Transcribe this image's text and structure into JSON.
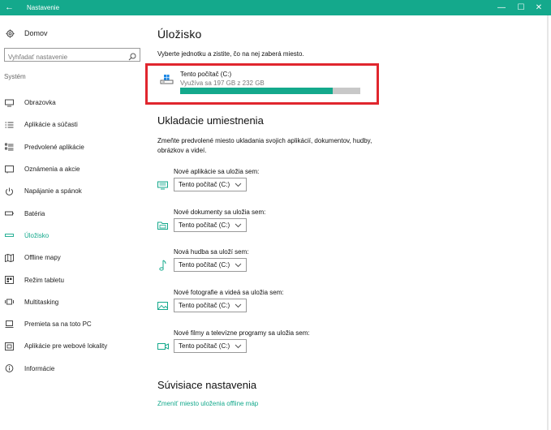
{
  "window": {
    "title": "Nastavenie",
    "back_glyph": "←",
    "minimize_glyph": "—",
    "maximize_glyph": "☐",
    "close_glyph": "✕",
    "accent_color": "#14a98c"
  },
  "sidebar": {
    "home_label": "Domov",
    "search_placeholder": "Vyhľadať nastavenie",
    "section_label": "Systém",
    "items": [
      {
        "label": "Obrazovka",
        "icon": "monitor-icon",
        "active": false
      },
      {
        "label": "Aplikácie a súčasti",
        "icon": "apps-list-icon",
        "active": false
      },
      {
        "label": "Predvolené aplikácie",
        "icon": "default-apps-icon",
        "active": false
      },
      {
        "label": "Oznámenia a akcie",
        "icon": "notifications-icon",
        "active": false
      },
      {
        "label": "Napájanie a spánok",
        "icon": "power-icon",
        "active": false
      },
      {
        "label": "Batéria",
        "icon": "battery-icon",
        "active": false
      },
      {
        "label": "Úložisko",
        "icon": "storage-icon",
        "active": true
      },
      {
        "label": "Offline mapy",
        "icon": "map-icon",
        "active": false
      },
      {
        "label": "Režim tabletu",
        "icon": "tablet-mode-icon",
        "active": false
      },
      {
        "label": "Multitasking",
        "icon": "multitasking-icon",
        "active": false
      },
      {
        "label": "Premieta sa na toto PC",
        "icon": "projecting-icon",
        "active": false
      },
      {
        "label": "Aplikácie pre webové lokality",
        "icon": "web-apps-icon",
        "active": false
      },
      {
        "label": "Informácie",
        "icon": "info-icon",
        "active": false
      }
    ]
  },
  "storage": {
    "title": "Úložisko",
    "subtitle": "Vyberte jednotku a zistite, čo na nej zaberá miesto.",
    "drive": {
      "name": "Tento počítač (C:)",
      "usage_text": "Využíva sa 197 GB z 232 GB",
      "used_fraction": 0.849
    }
  },
  "save_locations": {
    "title": "Ukladacie umiestnenia",
    "description": "Zmeňte predvolené miesto ukladania svojich aplikácií, dokumentov, hudby, obrázkov a videí.",
    "groups": [
      {
        "label": "Nové aplikácie sa uložia sem:",
        "value": "Tento počítač (C:)",
        "icon": "apps-save-icon"
      },
      {
        "label": "Nové dokumenty sa uložia sem:",
        "value": "Tento počítač (C:)",
        "icon": "documents-folder-icon"
      },
      {
        "label": "Nová hudba sa uloží sem:",
        "value": "Tento počítač (C:)",
        "icon": "music-note-icon"
      },
      {
        "label": "Nové fotografie a videá sa uložia sem:",
        "value": "Tento počítač (C:)",
        "icon": "photos-icon"
      },
      {
        "label": "Nové filmy a televízne programy sa uložia sem:",
        "value": "Tento počítač (C:)",
        "icon": "video-camera-icon"
      }
    ]
  },
  "related": {
    "title": "Súvisiace nastavenia",
    "link": "Zmeniť miesto uloženia offline máp"
  }
}
